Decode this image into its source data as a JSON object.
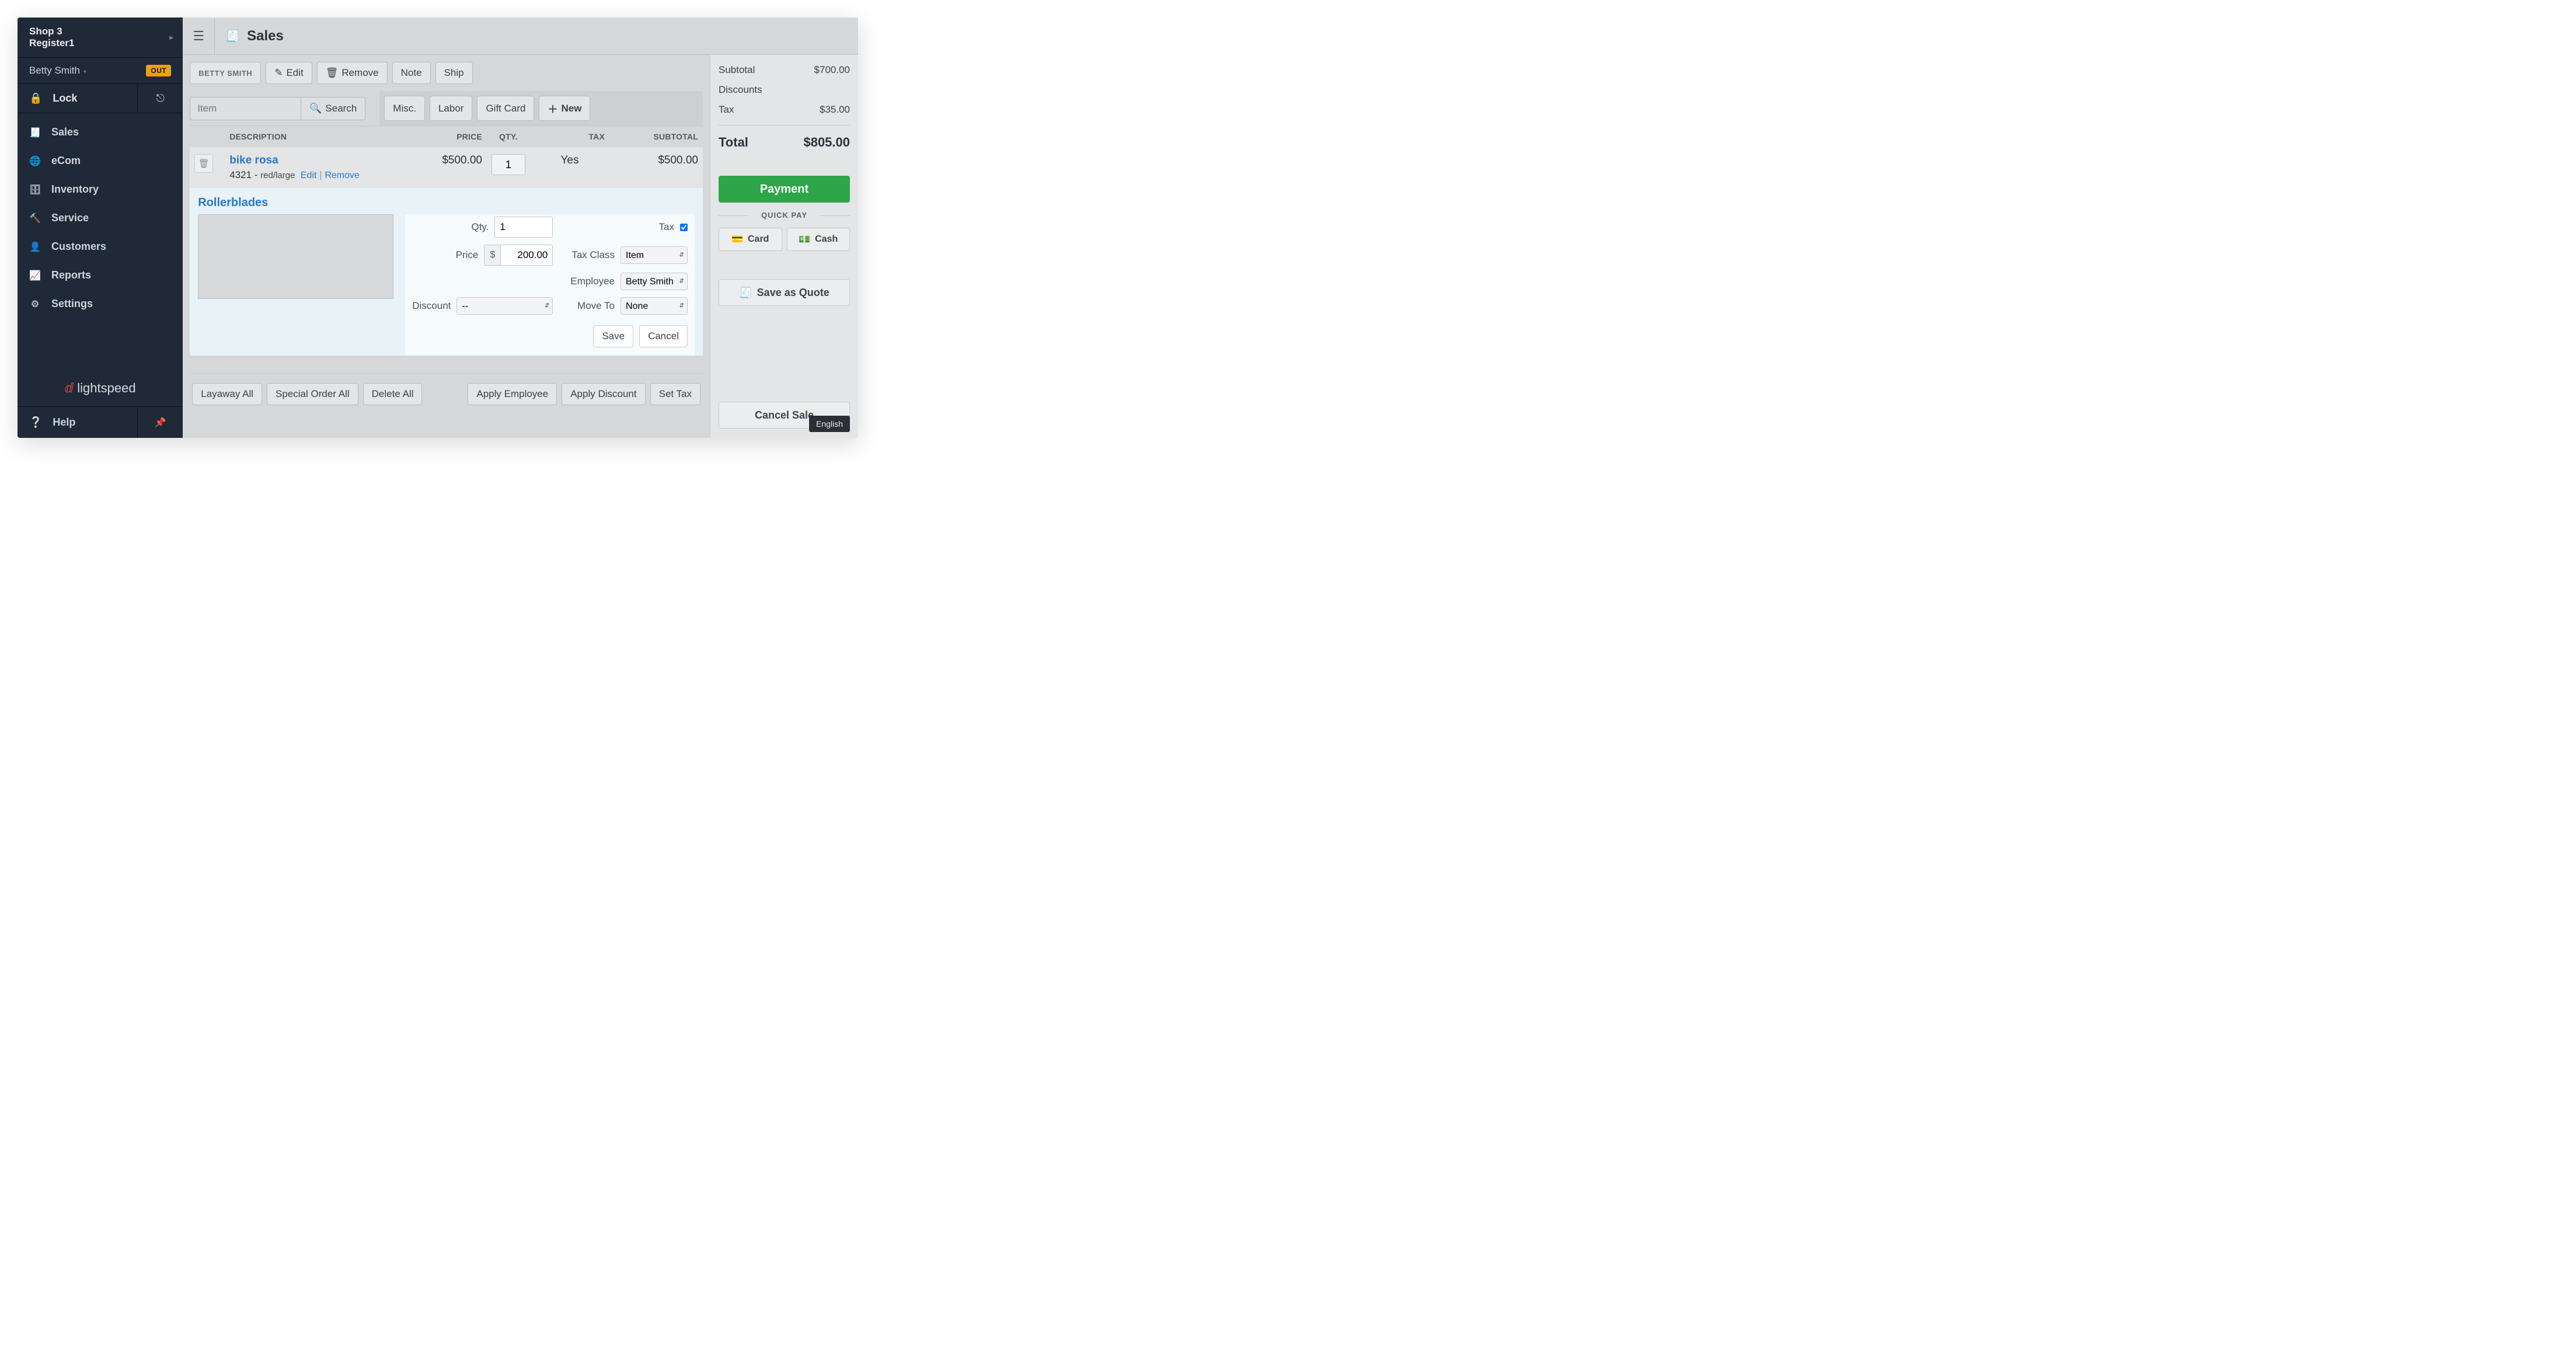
{
  "sidebar": {
    "shop": "Shop 3",
    "register": "Register1",
    "user": "Betty Smith",
    "out_badge": "OUT",
    "lock": "Lock",
    "items": [
      {
        "label": "Sales"
      },
      {
        "label": "eCom"
      },
      {
        "label": "Inventory"
      },
      {
        "label": "Service"
      },
      {
        "label": "Customers"
      },
      {
        "label": "Reports"
      },
      {
        "label": "Settings"
      }
    ],
    "brand": "lightspeed",
    "help": "Help"
  },
  "topbar": {
    "title": "Sales"
  },
  "toolbar": {
    "customer": "BETTY SMITH",
    "edit": "Edit",
    "remove": "Remove",
    "note": "Note",
    "ship": "Ship",
    "item_placeholder": "Item",
    "search": "Search",
    "misc": "Misc.",
    "labor": "Labor",
    "giftcard": "Gift Card",
    "new": "New"
  },
  "headers": {
    "description": "DESCRIPTION",
    "price": "PRICE",
    "qty": "QTY.",
    "tax": "TAX",
    "subtotal": "SUBTOTAL"
  },
  "line1": {
    "name": "bike rosa",
    "sku": "4321",
    "variant": "red/large",
    "edit": "Edit",
    "remove": "Remove",
    "price": "$500.00",
    "qty": "1",
    "tax": "Yes",
    "subtotal": "$500.00"
  },
  "line2": {
    "name": "Rollerblades",
    "note": "",
    "qty_label": "Qty.",
    "qty": "1",
    "price_label": "Price",
    "price_prefix": "$",
    "price": "200.00",
    "discount_label": "Discount",
    "discount_value": "--",
    "tax_label": "Tax",
    "tax_checked": true,
    "taxclass_label": "Tax Class",
    "taxclass_value": "Item",
    "employee_label": "Employee",
    "employee_value": "Betty Smith",
    "moveto_label": "Move To",
    "moveto_value": "None",
    "save": "Save",
    "cancel": "Cancel"
  },
  "footer": {
    "layaway": "Layaway All",
    "special": "Special Order All",
    "delete": "Delete All",
    "apply_emp": "Apply Employee",
    "apply_disc": "Apply Discount",
    "set_tax": "Set Tax"
  },
  "summary": {
    "subtotal_label": "Subtotal",
    "subtotal": "$700.00",
    "discounts_label": "Discounts",
    "discounts": "",
    "tax_label": "Tax",
    "tax": "$35.00",
    "total_label": "Total",
    "total": "$805.00",
    "payment": "Payment",
    "quickpay": "QUICK PAY",
    "card": "Card",
    "cash": "Cash",
    "save_quote": "Save as Quote",
    "cancel_sale": "Cancel Sale"
  },
  "lang": "English"
}
